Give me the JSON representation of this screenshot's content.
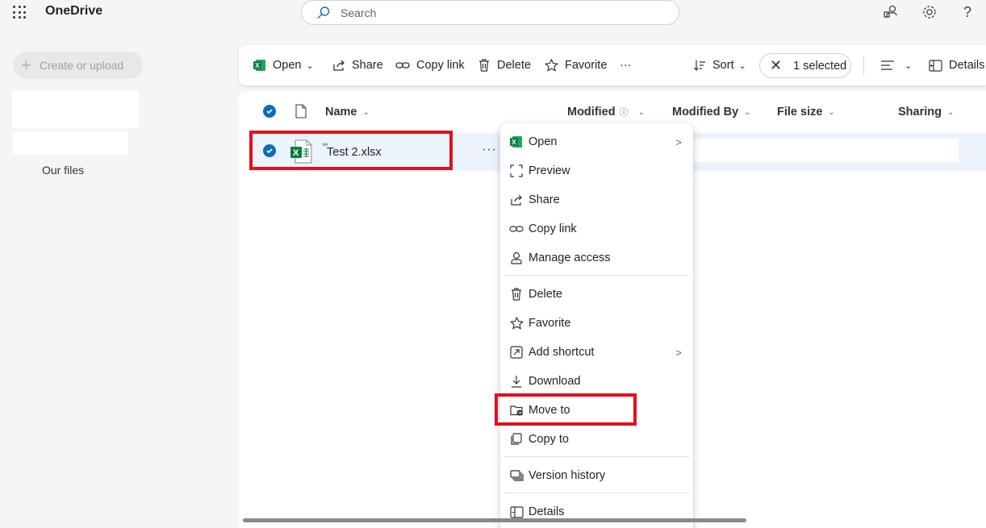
{
  "app": {
    "title": "OneDrive"
  },
  "search": {
    "placeholder": "Search"
  },
  "nav": {
    "create_label": "Create or upload",
    "our_files": "Our files"
  },
  "commandbar": {
    "open": "Open",
    "share": "Share",
    "copy_link": "Copy link",
    "delete": "Delete",
    "favorite": "Favorite",
    "more": "···",
    "sort": "Sort",
    "selected": "1 selected",
    "details": "Details"
  },
  "columns": {
    "name": "Name",
    "modified": "Modified",
    "modified_by": "Modified By",
    "file_size": "File size",
    "sharing": "Sharing"
  },
  "file": {
    "name": "Test 2.xlsx",
    "more": "···"
  },
  "menu": {
    "items": [
      "Open",
      "Preview",
      "Share",
      "Copy link",
      "Manage access",
      "Delete",
      "Favorite",
      "Add shortcut",
      "Download",
      "Move to",
      "Copy to",
      "Version history",
      "Details"
    ]
  },
  "colors": {
    "accent": "#0f6cbd",
    "highlight": "#e0101c",
    "excel": "#107c41"
  }
}
